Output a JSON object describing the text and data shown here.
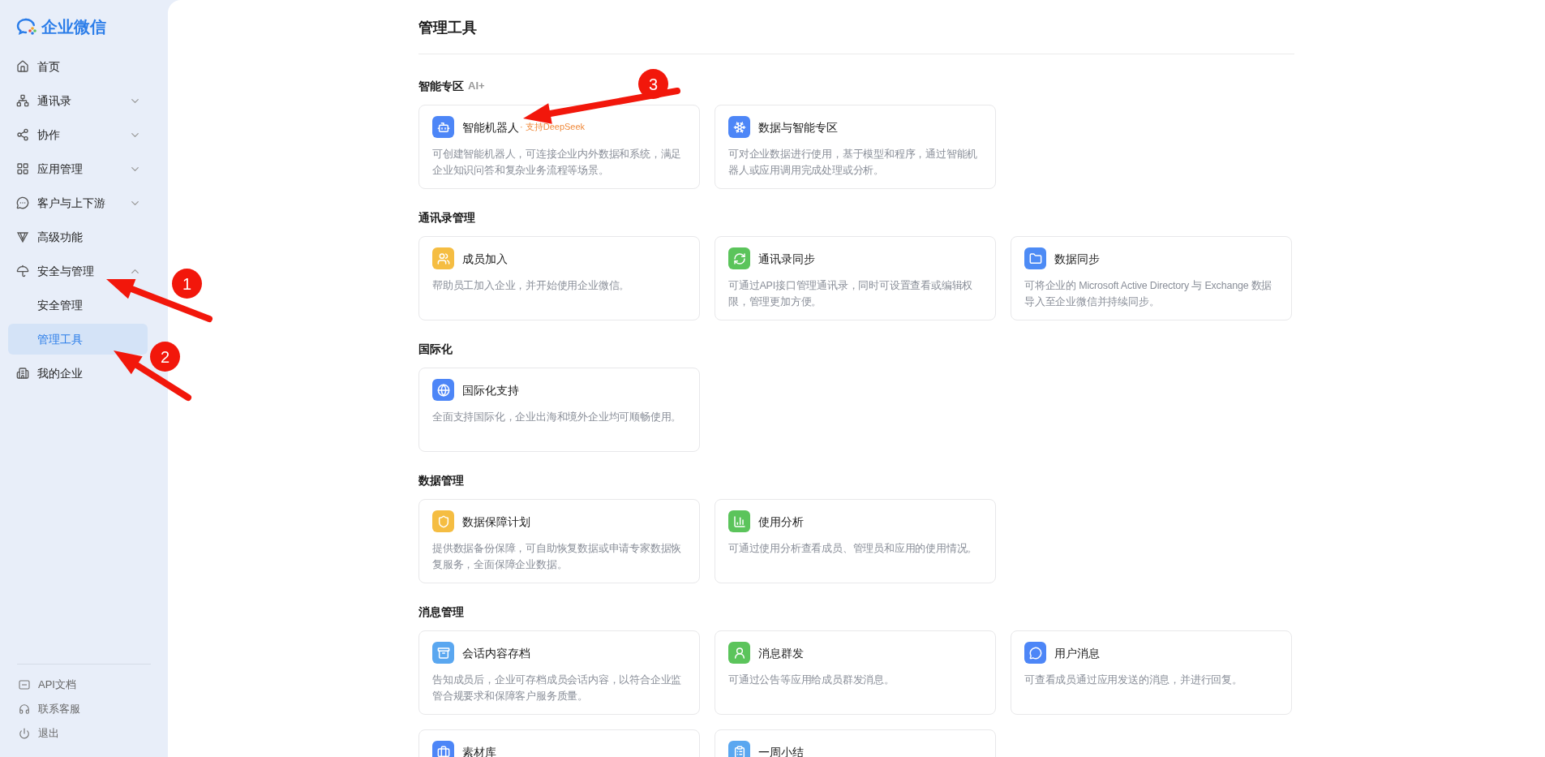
{
  "sidebar": {
    "logo": "企业微信",
    "items": [
      {
        "kind": "home",
        "label": "首页",
        "expandable": false,
        "selected": false
      },
      {
        "kind": "contacts",
        "label": "通讯录",
        "expandable": true,
        "expanded": false,
        "selected": false
      },
      {
        "kind": "collab",
        "label": "协作",
        "expandable": true,
        "expanded": false,
        "selected": false
      },
      {
        "kind": "apps",
        "label": "应用管理",
        "expandable": true,
        "expanded": false,
        "selected": false
      },
      {
        "kind": "customer",
        "label": "客户与上下游",
        "expandable": true,
        "expanded": false,
        "selected": false
      },
      {
        "kind": "advanced",
        "label": "高级功能",
        "expandable": false,
        "selected": false
      },
      {
        "kind": "security",
        "label": "安全与管理",
        "expandable": true,
        "expanded": true,
        "selected": false,
        "children": [
          {
            "label": "安全管理",
            "selected": false
          },
          {
            "label": "管理工具",
            "selected": true
          }
        ]
      },
      {
        "kind": "company",
        "label": "我的企业",
        "expandable": false,
        "selected": false
      }
    ],
    "footer": [
      {
        "kind": "api",
        "label": "API文档"
      },
      {
        "kind": "support",
        "label": "联系客服"
      },
      {
        "kind": "logout",
        "label": "退出"
      }
    ]
  },
  "main": {
    "title": "管理工具",
    "sections": [
      {
        "title": "智能专区",
        "tag": "AI+",
        "cards": [
          {
            "kind": "robot",
            "color": "#4d86f7",
            "title": "智能机器人",
            "badge": "· 支持DeepSeek",
            "description": "可创建智能机器人，可连接企业内外数据和系统，满足企业知识问答和复杂业务流程等场景。"
          },
          {
            "kind": "cube",
            "color": "#4d86f7",
            "title": "数据与智能专区",
            "description": "可对企业数据进行使用，基于模型和程序，通过智能机器人或应用调用完成处理或分析。"
          }
        ]
      },
      {
        "title": "通讯录管理",
        "cards": [
          {
            "kind": "people",
            "color": "#f5bd42",
            "title": "成员加入",
            "description": "帮助员工加入企业，并开始使用企业微信。"
          },
          {
            "kind": "sync",
            "color": "#5bc45b",
            "title": "通讯录同步",
            "description": "可通过API接口管理通讯录，同时可设置查看或编辑权限，管理更加方便。"
          },
          {
            "kind": "folder",
            "color": "#4d8bf5",
            "title": "数据同步",
            "description": "可将企业的 Microsoft Active Directory 与 Exchange 数据导入至企业微信并持续同步。"
          }
        ]
      },
      {
        "title": "国际化",
        "cards": [
          {
            "kind": "globe",
            "color": "#4d86f7",
            "title": "国际化支持",
            "description": "全面支持国际化，企业出海和境外企业均可顺畅使用。"
          }
        ]
      },
      {
        "title": "数据管理",
        "cards": [
          {
            "kind": "shield",
            "color": "#f5bd42",
            "title": "数据保障计划",
            "description": "提供数据备份保障，可自助恢复数据或申请专家数据恢复服务，全面保障企业数据。"
          },
          {
            "kind": "chart",
            "color": "#5bc45b",
            "title": "使用分析",
            "description": "可通过使用分析查看成员、管理员和应用的使用情况。"
          }
        ]
      },
      {
        "title": "消息管理",
        "cards": [
          {
            "kind": "archive",
            "color": "#5aa7f0",
            "title": "会话内容存档",
            "description": "告知成员后，企业可存档成员会话内容，以符合企业监管合规要求和保障客户服务质量。"
          },
          {
            "kind": "group",
            "color": "#5bc45b",
            "title": "消息群发",
            "description": "可通过公告等应用给成员群发消息。"
          },
          {
            "kind": "chat",
            "color": "#4d86f7",
            "title": "用户消息",
            "description": "可查看成员通过应用发送的消息，并进行回复。"
          },
          {
            "kind": "briefcase",
            "color": "#4d86f7",
            "title": "素材库"
          },
          {
            "kind": "clipboard",
            "color": "#5aa7f0",
            "title": "一周小结"
          }
        ]
      }
    ]
  },
  "annotations": [
    {
      "label": "1"
    },
    {
      "label": "2"
    },
    {
      "label": "3"
    }
  ]
}
